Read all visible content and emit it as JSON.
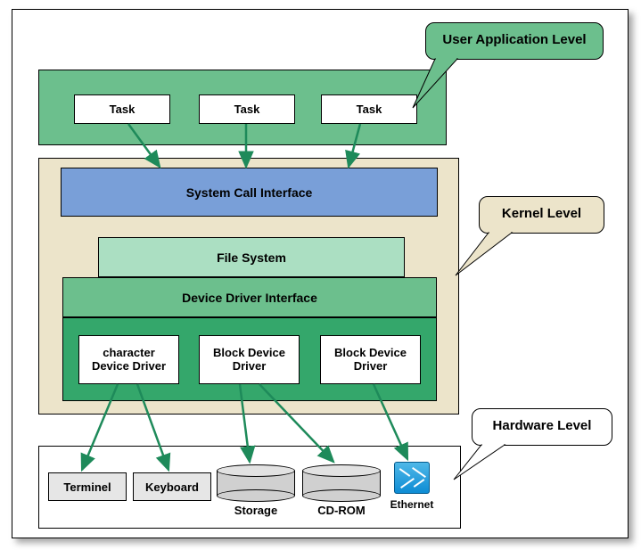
{
  "levels": {
    "user_app": "User Application Level",
    "kernel": "Kernel Level",
    "hardware": "Hardware Level"
  },
  "tasks": [
    "Task",
    "Task",
    "Task"
  ],
  "kernel_boxes": {
    "sys_call": "System Call Interface",
    "file_system": "File System",
    "dev_driver_if": "Device Driver Interface"
  },
  "drivers": [
    {
      "line1": "character",
      "line2": "Device Driver"
    },
    {
      "line1": "Block Device",
      "line2": "Driver"
    },
    {
      "line1": "Block Device",
      "line2": "Driver"
    }
  ],
  "hardware": {
    "terminal": "Terminel",
    "keyboard": "Keyboard",
    "storage": "Storage",
    "cdrom": "CD-ROM",
    "ethernet": "Ethernet"
  },
  "colors": {
    "green_dark": "#34a76b",
    "green_mid": "#6cbf8d",
    "green_light": "#abdfc2",
    "blue": "#799fd8",
    "beige": "#ece4ca",
    "arrow": "#1e8a5a"
  }
}
